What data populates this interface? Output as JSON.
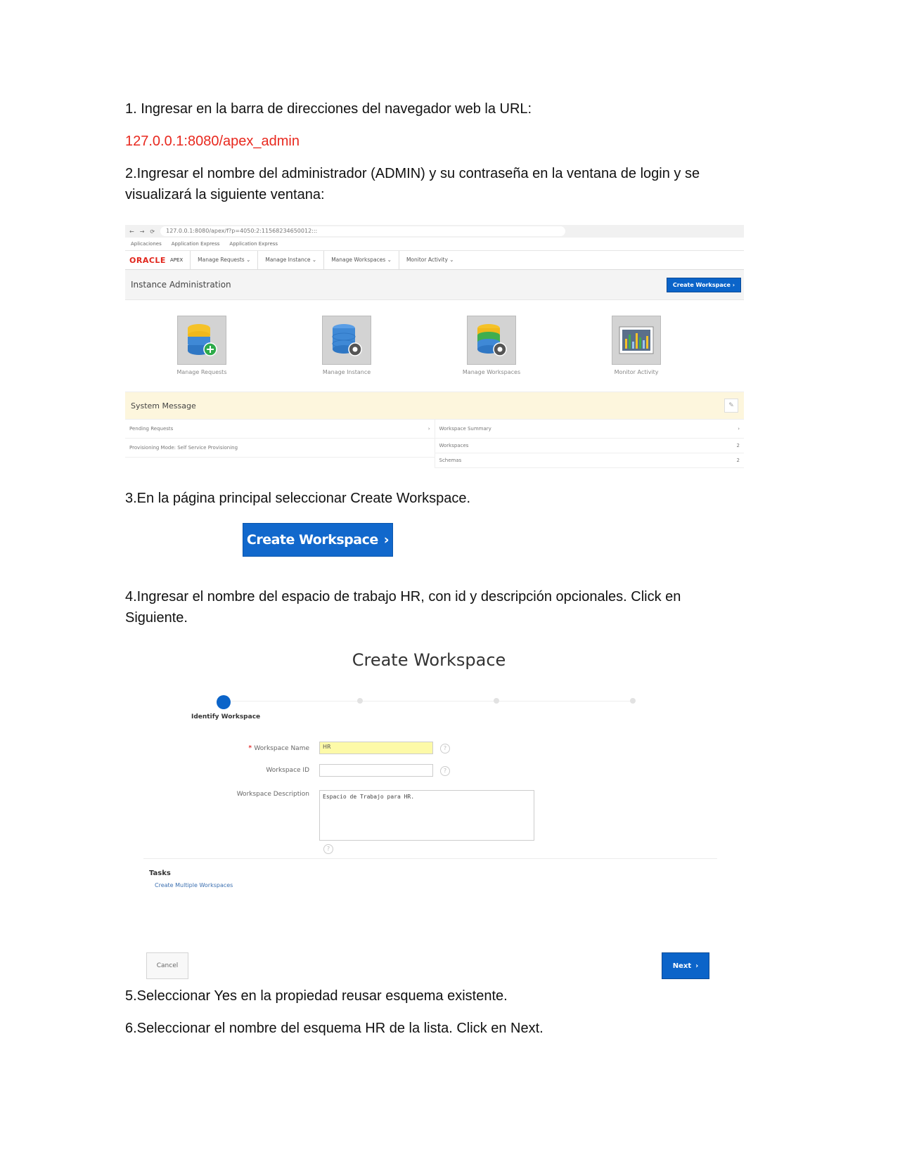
{
  "steps": {
    "s1": "1. Ingresar en la barra de direcciones del navegador web la URL:",
    "url": "127.0.0.1:8080/apex_admin",
    "s2": "2.Ingresar el nombre del administrador (ADMIN) y su contraseña en la ventana de login y se visualizará la siguiente ventana:",
    "s3": "3.En la página principal seleccionar Create Workspace.",
    "s4": "4.Ingresar el nombre del espacio de trabajo HR, con id  y descripción opcionales. Click en Siguiente.",
    "s5": "5.Seleccionar Yes en la propiedad reusar esquema existente.",
    "s6": "6.Seleccionar el nombre del esquema HR de la lista. Click en Next."
  },
  "shot1": {
    "address": "127.0.0.1:8080/apex/f?p=4050:2:11568234650012:::",
    "bookmarks": [
      "Aplicaciones",
      "Application Express",
      "Application Express"
    ],
    "brand": "ORACLE",
    "brand_sub": "APEX",
    "nav": [
      "Manage Requests",
      "Manage Instance",
      "Manage Workspaces",
      "Monitor Activity"
    ],
    "page_title": "Instance Administration",
    "create_button": "Create Workspace",
    "icons": [
      {
        "label": "Manage Requests",
        "icon": "database-add-icon"
      },
      {
        "label": "Manage Instance",
        "icon": "database-gear-icon"
      },
      {
        "label": "Manage Workspaces",
        "icon": "database-gear-icon"
      },
      {
        "label": "Monitor Activity",
        "icon": "bar-chart-icon"
      }
    ],
    "system_message": "System Message",
    "left_panel": {
      "title": "Pending Requests",
      "row": "Provisioning Mode: Self Service Provisioning"
    },
    "right_panel": {
      "title": "Workspace Summary",
      "rows": [
        {
          "label": "Workspaces",
          "value": "2"
        },
        {
          "label": "Schemas",
          "value": "2"
        }
      ]
    }
  },
  "big_button": {
    "label": "Create Workspace"
  },
  "shot2": {
    "title": "Create Workspace",
    "step_label": "Identify Workspace",
    "workspace_name_label": "Workspace Name",
    "workspace_name_value": "HR",
    "workspace_id_label": "Workspace ID",
    "workspace_id_value": "",
    "description_label": "Workspace Description",
    "description_value": "Espacio de Trabajo para HR.",
    "tasks_heading": "Tasks",
    "task_link": "Create Multiple Workspaces",
    "cancel": "Cancel",
    "next": "Next"
  },
  "colors": {
    "url": "#e8281e",
    "primary": "#0b64c9",
    "oracle": "#e1251b",
    "system_message_bg": "#fdf6dd"
  }
}
